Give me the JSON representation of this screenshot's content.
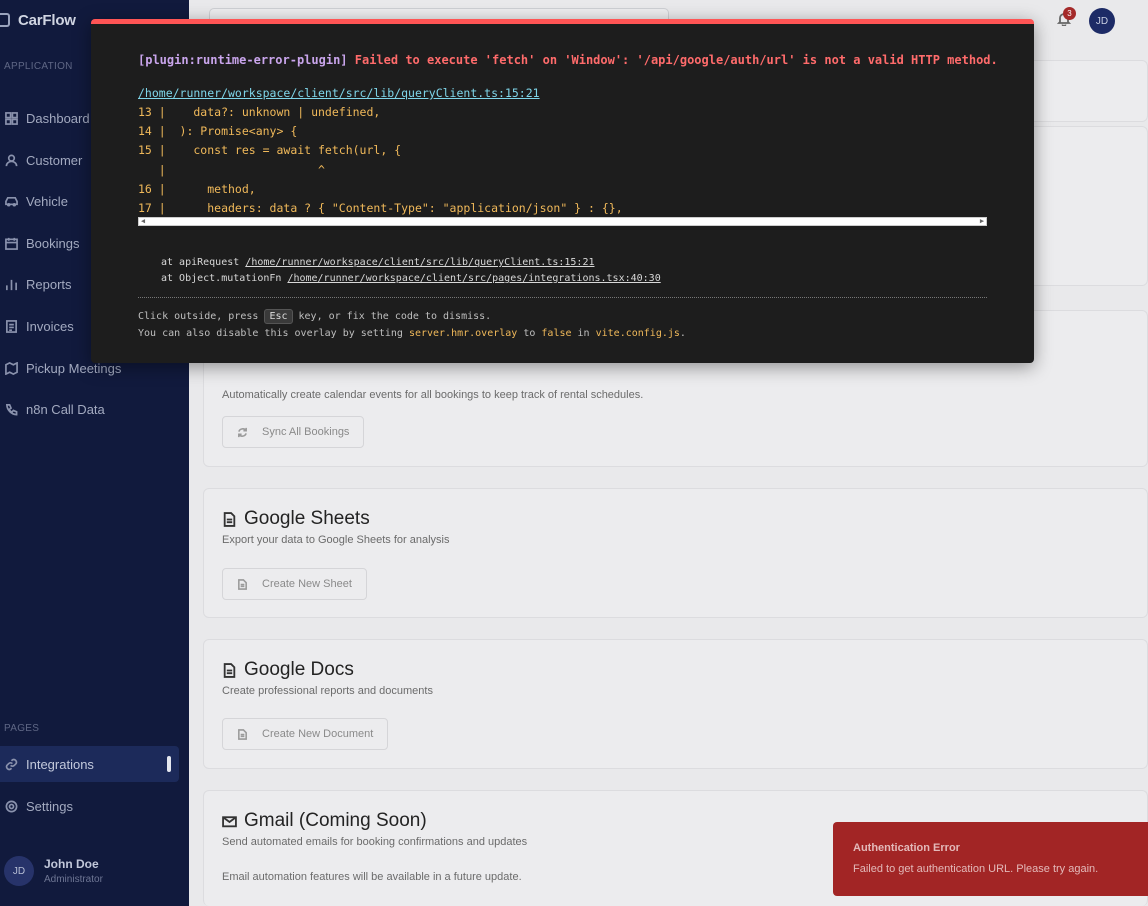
{
  "sidebar": {
    "brand": "CarFlow",
    "section_application": "APPLICATION",
    "section_pages": "PAGES",
    "items": [
      {
        "label": "Dashboard",
        "icon": "grid-icon"
      },
      {
        "label": "Customer",
        "icon": "user-icon"
      },
      {
        "label": "Vehicle",
        "icon": "car-icon"
      },
      {
        "label": "Bookings",
        "icon": "calendar-icon"
      },
      {
        "label": "Reports",
        "icon": "bar-chart-icon"
      },
      {
        "label": "Invoices",
        "icon": "document-icon"
      },
      {
        "label": "Pickup Meetings",
        "icon": "map-icon"
      },
      {
        "label": "n8n Call Data",
        "icon": "phone-icon"
      }
    ],
    "pages": [
      {
        "label": "Integrations",
        "icon": "link-icon",
        "active": true
      },
      {
        "label": "Settings",
        "icon": "gear-icon"
      }
    ],
    "user": {
      "initials": "JD",
      "name": "John Doe",
      "role": "Administrator"
    }
  },
  "header": {
    "notification_count": "3",
    "avatar_initials": "JD"
  },
  "cards": {
    "calendar": {
      "description": "Automatically create calendar events for all bookings to keep track of rental schedules.",
      "button": "Sync All Bookings"
    },
    "sheets": {
      "title": "Google Sheets",
      "subtitle": "Export your data to Google Sheets for analysis",
      "button": "Create New Sheet"
    },
    "docs": {
      "title": "Google Docs",
      "subtitle": "Create professional reports and documents",
      "button": "Create New Document"
    },
    "gmail": {
      "title": "Gmail (Coming Soon)",
      "subtitle": "Send automated emails for booking confirmations and updates",
      "note": "Email automation features will be available in a future update."
    }
  },
  "toast": {
    "title": "Authentication Error",
    "description": "Failed to get authentication URL. Please try again."
  },
  "overlay": {
    "plugin": "[plugin:runtime-error-plugin]",
    "message": "Failed to execute 'fetch' on 'Window': '/api/google/auth/url' is not a valid HTTP method.",
    "file": "/home/runner/workspace/client/src/lib/queryClient.ts:15:21",
    "frame_lines": [
      "13 |    data?: unknown | undefined,",
      "14 |  ): Promise<any> {",
      "15 |    const res = await fetch(url, {",
      "   |                      ^",
      "16 |      method,",
      "17 |      headers: data ? { \"Content-Type\": \"application/json\" } : {},"
    ],
    "stack": [
      {
        "prefix": "at apiRequest ",
        "link": "/home/runner/workspace/client/src/lib/queryClient.ts:15:21"
      },
      {
        "prefix": "at Object.mutationFn ",
        "link": "/home/runner/workspace/client/src/pages/integrations.tsx:40:30"
      }
    ],
    "tip1_a": "Click outside, press ",
    "tip1_key": "Esc",
    "tip1_b": " key, or fix the code to dismiss.",
    "tip2_a": "You can also disable this overlay by setting ",
    "tip2_code1": "server.hmr.overlay",
    "tip2_b": " to ",
    "tip2_code2": "false",
    "tip2_c": " in ",
    "tip2_code3": "vite.config.js",
    "tip2_d": "."
  }
}
